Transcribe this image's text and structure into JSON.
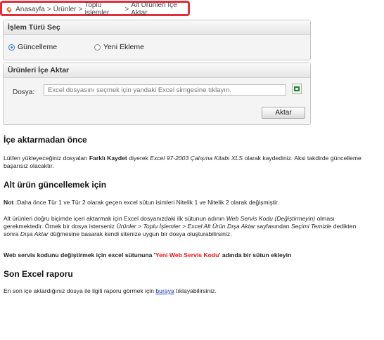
{
  "breadcrumb": {
    "items": [
      "Anasayfa",
      "Ürünler",
      "Toplu İşlemler",
      "Alt Ürünleri İçe Aktar"
    ],
    "separator": ">"
  },
  "islem_panel": {
    "title": "İşlem Türü Seç",
    "options": [
      {
        "label": "Güncelleme",
        "selected": true
      },
      {
        "label": "Yeni Ekleme",
        "selected": false
      }
    ]
  },
  "import_panel": {
    "title": "Ürünleri İçe Aktar",
    "file_label": "Dosya:",
    "file_placeholder": "Excel dosyasını seçmek için yandaki Excel simgesine tıklayın.",
    "excel_icon": "excel-file-icon",
    "submit_label": "Aktar"
  },
  "sections": {
    "s1_title": "İçe aktarmadan önce",
    "s1_text_1": "Lütfen yükleyeceğiniz dosyaları ",
    "s1_bold": "Farklı Kaydet",
    "s1_text_2": " diyerek ",
    "s1_italic": "Excel 97-2003 Çalışma Kitabı XLS",
    "s1_text_3": " olarak kaydediniz. Aksi takdirde güncelleme başarısız olacaktır.",
    "s2_title": "Alt ürün güncellemek için",
    "s2_note_label": "Not",
    "s2_note_text": " :Daha önce Tür 1 ve Tür 2 olarak geçen excel sütun isimleri Nitelik 1 ve Nitelik 2 olarak değişmiştir.",
    "s2_p2_a": "Alt ürünleri doğru biçimde içeri aktarmak için Excel dosyanızdaki ilk sütunun adının ",
    "s2_p2_i1": "Web Servis Kodu (Değiştirmeyin)",
    "s2_p2_b": " olması gerekmektedir. Örnek bir dosya isterseniz ",
    "s2_p2_i2": "Ürünler > Toplu İşlemler > Excel Alt Ürün Dışa Aktar",
    "s2_p2_c": " sayfasından ",
    "s2_p2_i3": "Seçimi Temizle",
    "s2_p2_d": " dedikten sonra ",
    "s2_p2_i4": "Dışa Aktar",
    "s2_p2_e": " düğmesine basarak kendi sitenize uygun bir dosya oluşturabilirsiniz.",
    "s2_p3_a": "Web servis kodunu değiştirmek için excel sütununa '",
    "s2_p3_red": "Yeni Web Servis Kodu",
    "s2_p3_b": "' adında bir sütun ekleyin",
    "s3_title": "Son Excel raporu",
    "s3_text_a": "En son içe aktardığınız dosya ile ilgili raporu görmek için ",
    "s3_link": "buraya",
    "s3_text_b": " tıklayabilirsiniz."
  },
  "colors": {
    "highlight": "#e02f3c",
    "link": "#1a3fbf",
    "warning_red": "#ee1111"
  }
}
